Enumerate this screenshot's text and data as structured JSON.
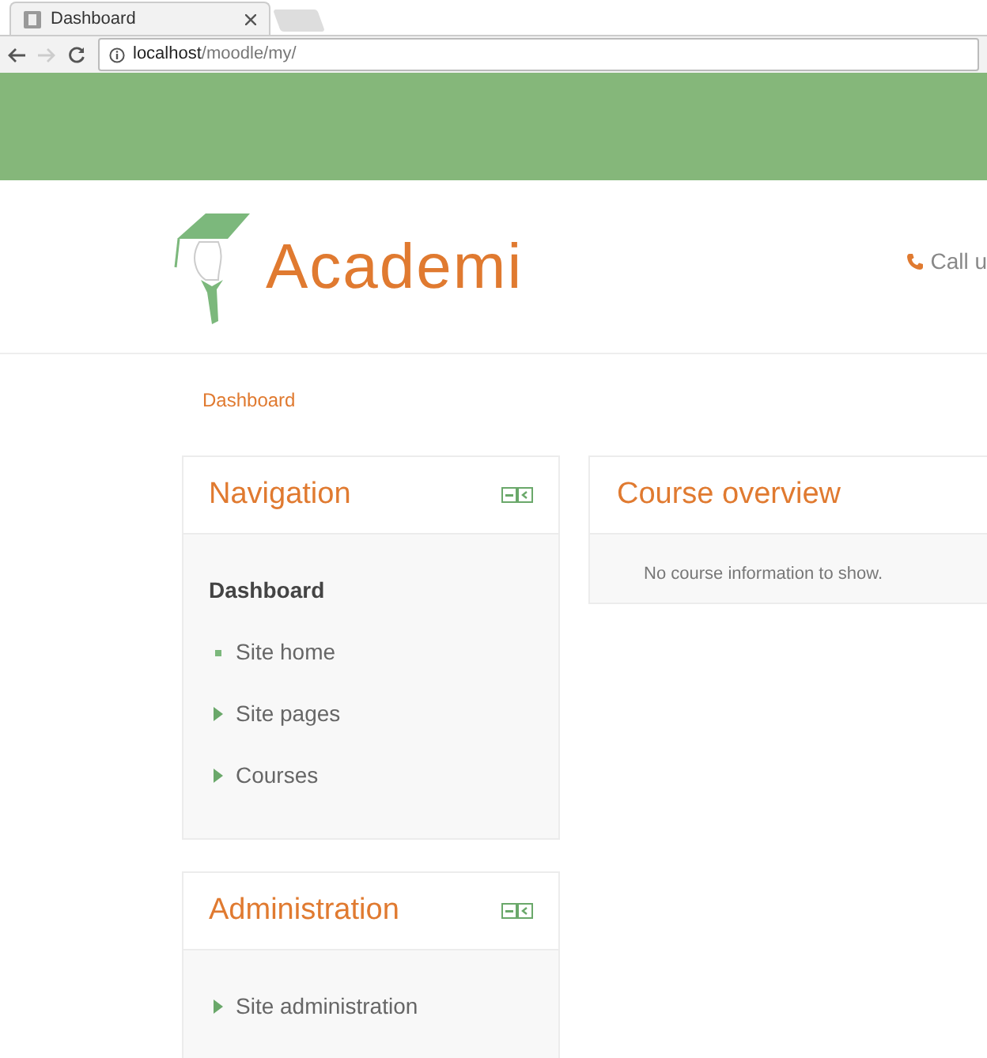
{
  "browser": {
    "tab_title": "Dashboard",
    "address_host": "localhost",
    "address_path": "/moodle/my/"
  },
  "header": {
    "logo_text": "Academi",
    "contact_text": "Call u"
  },
  "breadcrumb": "Dashboard",
  "blocks": [
    {
      "title": "Navigation",
      "items": [
        {
          "kind": "heading",
          "label": "Dashboard"
        },
        {
          "kind": "leaf",
          "label": "Site home"
        },
        {
          "kind": "branch",
          "label": "Site pages"
        },
        {
          "kind": "branch",
          "label": "Courses"
        }
      ]
    },
    {
      "title": "Administration",
      "items": [
        {
          "kind": "branch",
          "label": "Site administration"
        }
      ]
    }
  ],
  "main": {
    "title": "Course overview",
    "message": "No course information to show."
  }
}
